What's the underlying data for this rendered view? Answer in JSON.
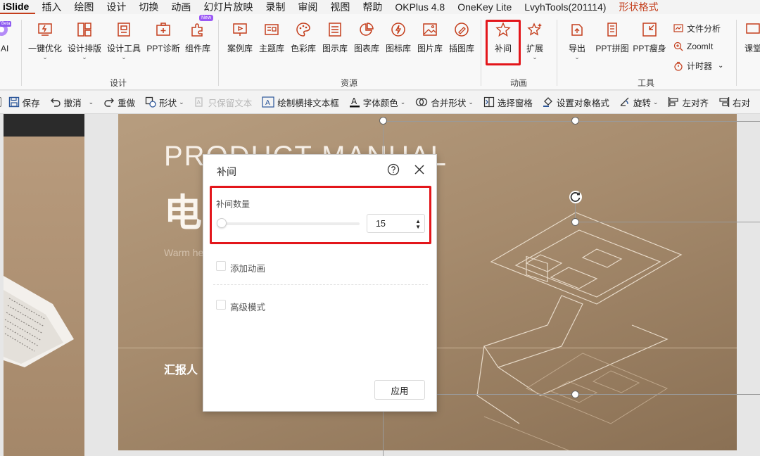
{
  "menu": {
    "tabs": [
      "iSlide",
      "插入",
      "绘图",
      "设计",
      "切换",
      "动画",
      "幻灯片放映",
      "录制",
      "审阅",
      "视图",
      "帮助",
      "OKPlus 4.8",
      "OneKey Lite",
      "LvyhTools(201114)",
      "形状格式"
    ]
  },
  "ribbon": {
    "ai_label": "e AI",
    "ai_badge": "Beta",
    "new_badge": "New",
    "buttons": {
      "one_click": "一键优化",
      "layout": "设计排版",
      "design_tools": "设计工具",
      "diagnose": "PPT诊断",
      "components": "组件库",
      "cases": "案例库",
      "themes": "主题库",
      "colors": "色彩库",
      "diagrams": "图示库",
      "charts": "图表库",
      "icons": "图标库",
      "pictures": "图片库",
      "illustrations": "插图库",
      "tween": "补间",
      "extend": "扩展",
      "export": "导出",
      "ppt_stitch": "PPT拼图",
      "ppt_slim": "PPT瘦身",
      "file_analysis": "文件分析",
      "zoomit": "ZoomIt",
      "timer": "计时器",
      "classroom": "课堂"
    },
    "groups": {
      "design": "设计",
      "resources": "资源",
      "animation": "动画",
      "tools": "工具"
    }
  },
  "quickbar": {
    "save": "保存",
    "undo": "撤消",
    "redo": "重做",
    "shape": "形状",
    "keep_text": "只保留文本",
    "draw_textbox": "绘制横排文本框",
    "font_color": "字体颜色",
    "merge_shapes": "合并形状",
    "selection_pane": "选择窗格",
    "format_object": "设置对象格式",
    "rotate": "旋转",
    "align_left": "左对齐",
    "align_right": "右对"
  },
  "slide": {
    "title_en": "PRODUCT MANUAL",
    "title_cn": "电",
    "subtitle": "Warm he",
    "reporter": "汇报人"
  },
  "dialog": {
    "title": "补间",
    "quantity_label": "补间数量",
    "quantity_value": "15",
    "slider_fraction": 0.03,
    "add_animation": "添加动画",
    "advanced_mode": "高级模式",
    "apply": "应用"
  },
  "colors": {
    "accent": "#c43e1c",
    "highlight": "#e3161b",
    "slide_bg": "#a68b6d"
  }
}
